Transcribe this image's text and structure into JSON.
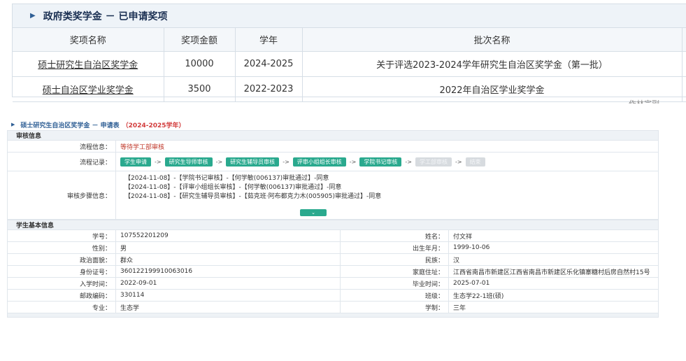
{
  "top": {
    "title": "政府类奖学金 － 已申请奖项",
    "headers": [
      "奖项名称",
      "奖项金额",
      "学年",
      "批次名称"
    ],
    "rows": [
      {
        "name": "硕士研究生自治区奖学金",
        "amount": "10000",
        "year": "2024-2025",
        "batch": "关于评选2023-2024学年研究生自治区奖学金（第一批）"
      },
      {
        "name": "硕士自治区学业奖学金",
        "amount": "3500",
        "year": "2022-2023",
        "batch": "2022年自治区学业奖学金"
      }
    ],
    "corner_text": "作林宗副"
  },
  "form": {
    "title": "硕士研究生自治区奖学金 － 申请表",
    "year_tag": "（2024-2025学年）",
    "review_section": "审核信息",
    "flow_info_label": "流程信息：",
    "flow_info_value": "等待学工部审核",
    "flow_record_label": "流程记录：",
    "flow_steps": [
      {
        "label": "学生申请",
        "status": "done"
      },
      {
        "label": "研究生导师审核",
        "status": "done"
      },
      {
        "label": "研究生辅导员审核",
        "status": "done"
      },
      {
        "label": "评审小组组长审核",
        "status": "done"
      },
      {
        "label": "学院书记审核",
        "status": "done"
      },
      {
        "label": "学工部审核",
        "status": "pending"
      },
      {
        "label": "结束",
        "status": "pending"
      }
    ],
    "arrow": "->",
    "steps_label": "审核步骤信息：",
    "steps_log": [
      "【2024-11-08】-【学院书记审核】-【何学敏(006137)审批通过】-同意",
      "【2024-11-08】-【评审小组组长审核】-【何学敏(006137)审批通过】-同意",
      "【2024-11-08】-【研究生辅导员审核】-【茹克班·阿布都克力木(005905)审批通过】-同意"
    ],
    "expand_icon": "chevron-down-icon",
    "student_section": "学生基本信息",
    "student_rows": [
      [
        {
          "label": "学号：",
          "value": "107552201209"
        },
        {
          "label": "姓名：",
          "value": "付文祥"
        }
      ],
      [
        {
          "label": "性别：",
          "value": "男"
        },
        {
          "label": "出生年月：",
          "value": "1999-10-06"
        }
      ],
      [
        {
          "label": "政治面貌：",
          "value": "群众"
        },
        {
          "label": "民族：",
          "value": "汉"
        }
      ],
      [
        {
          "label": "身份证号：",
          "value": "360122199910063016"
        },
        {
          "label": "家庭住址：",
          "value": "江西省南昌市新建区江西省南昌市新建区乐化镇寨糖村后房自然村15号"
        }
      ],
      [
        {
          "label": "入学时间：",
          "value": "2022-09-01"
        },
        {
          "label": "毕业时间：",
          "value": "2025-07-01"
        }
      ],
      [
        {
          "label": "邮政编码：",
          "value": "330114"
        },
        {
          "label": "班级：",
          "value": "生态学22-1班(硕)"
        }
      ],
      [
        {
          "label": "专业：",
          "value": "生态学"
        },
        {
          "label": "学制：",
          "value": "三年"
        }
      ]
    ]
  },
  "colors": {
    "accent": "#2aa98e",
    "title": "#1a2f52",
    "red": "#c0392b",
    "pending": "#d7dbdf"
  }
}
